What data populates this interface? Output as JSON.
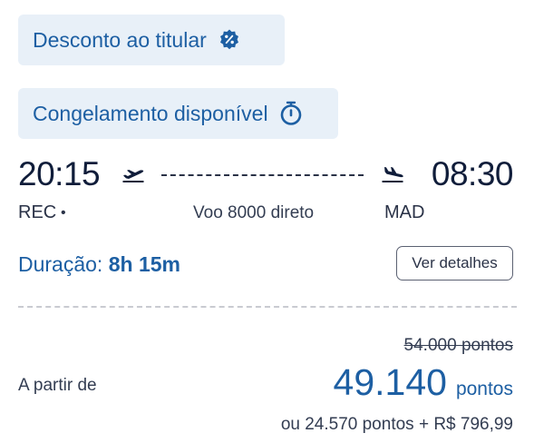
{
  "badges": {
    "discount_label": "Desconto ao titular",
    "discount_icon": "discount-badge-icon",
    "freeze_label": "Congelamento disponível",
    "freeze_icon": "stopwatch-icon"
  },
  "flight": {
    "departure_time": "20:15",
    "arrival_time": "08:30",
    "departure_code": "REC",
    "departure_dot": "•",
    "arrival_code": "MAD",
    "info": "Voo 8000 direto",
    "takeoff_icon": "plane-takeoff-icon",
    "landing_icon": "plane-landing-icon"
  },
  "duration": {
    "label": "Duração:",
    "value": "8h 15m"
  },
  "actions": {
    "details_label": "Ver detalhes"
  },
  "pricing": {
    "old_price": "54.000 pontos",
    "from_label": "A partir de",
    "price_value": "49.140",
    "price_unit": "pontos",
    "alt_price": "ou 24.570 pontos + R$ 796,99"
  },
  "colors": {
    "accent": "#1d5fa3",
    "chip_background": "#e8f0f8",
    "text_dark": "#101d3a"
  }
}
